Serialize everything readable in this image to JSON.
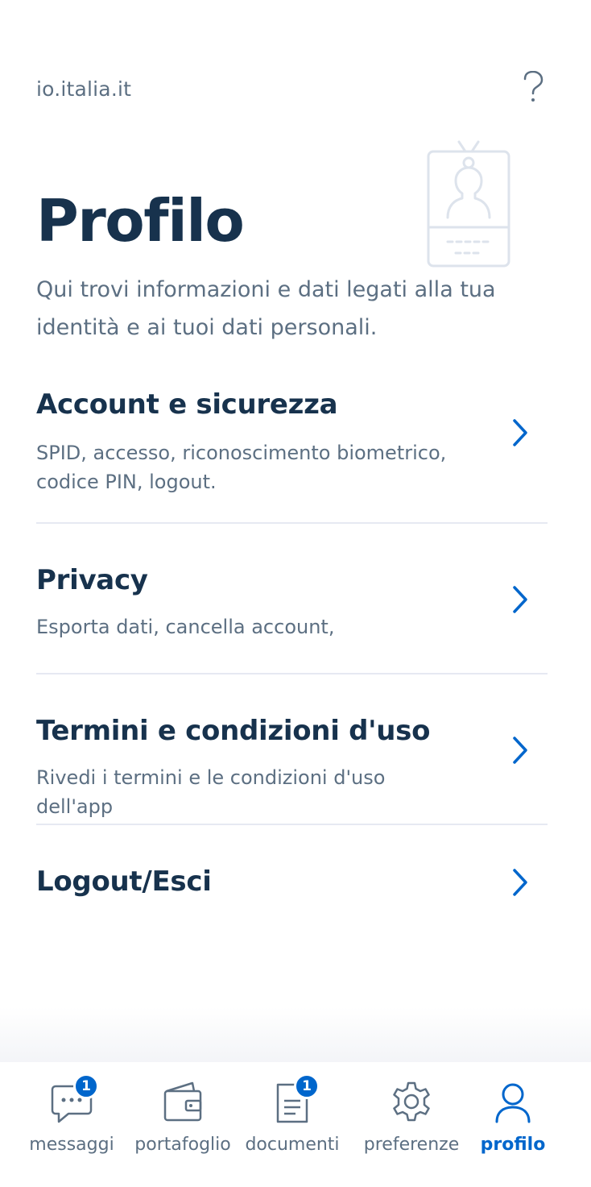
{
  "topbar": {
    "brand": "io.italia.it",
    "help_label": "?"
  },
  "header": {
    "title": "Profilo",
    "subtitle": "Qui trovi informazioni e dati legati alla tua identità e ai tuoi dati personali."
  },
  "items": [
    {
      "title": "Account e sicurezza",
      "desc": "SPID, accesso, riconoscimento biometrico, codice PIN, logout."
    },
    {
      "title": "Privacy",
      "desc": "Esporta dati, cancella account,"
    },
    {
      "title": "Termini e condizioni d'uso",
      "desc": "Rivedi i termini e le condizioni d'uso dell'app"
    },
    {
      "title": "Logout/Esci",
      "desc": ""
    }
  ],
  "tabs": [
    {
      "label": "messaggi",
      "badge": "1"
    },
    {
      "label": "portafoglio"
    },
    {
      "label": "documenti",
      "badge": "1"
    },
    {
      "label": "preferenze"
    },
    {
      "label": "profilo",
      "active": true
    }
  ],
  "colors": {
    "primary": "#0066cc",
    "title": "#17324d",
    "text": "#5c6f82",
    "divider": "#e6e9f2"
  }
}
